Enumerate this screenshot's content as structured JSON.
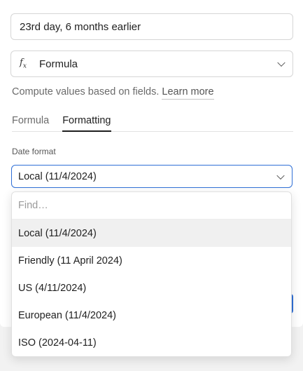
{
  "field": {
    "name_value": "23rd day, 6 months earlier",
    "type_icon": "fx-icon",
    "type_label": "Formula",
    "helper_text": "Compute values based on fields.",
    "learn_more": "Learn more"
  },
  "tabs": [
    {
      "label": "Formula",
      "active": false
    },
    {
      "label": "Formatting",
      "active": true
    }
  ],
  "date_format": {
    "label": "Date format",
    "selected": "Local (11/4/2024)",
    "find_placeholder": "Find…",
    "options": [
      "Local (11/4/2024)",
      "Friendly (11 April 2024)",
      "US (4/11/2024)",
      "European (11/4/2024)",
      "ISO (2024-04-11)"
    ]
  },
  "colors": {
    "accent": "#2f6fd6",
    "selected_row": "#f0f0f0"
  }
}
